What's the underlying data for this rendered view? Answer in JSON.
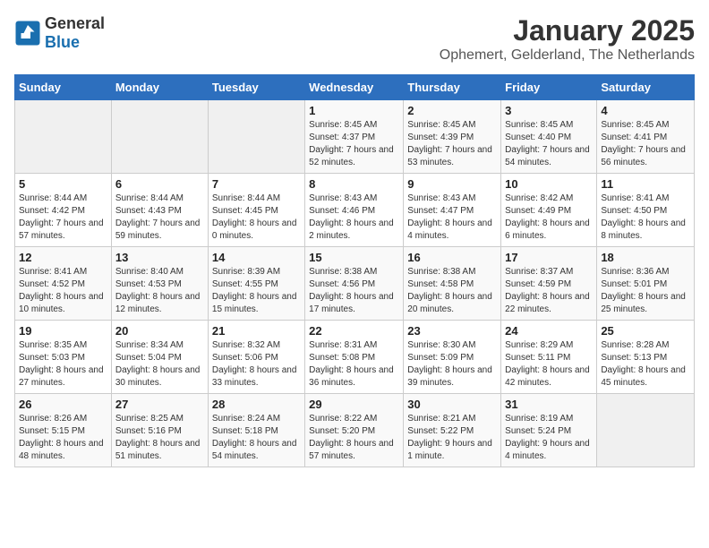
{
  "header": {
    "logo_general": "General",
    "logo_blue": "Blue",
    "month_year": "January 2025",
    "location": "Ophemert, Gelderland, The Netherlands"
  },
  "calendar": {
    "days_of_week": [
      "Sunday",
      "Monday",
      "Tuesday",
      "Wednesday",
      "Thursday",
      "Friday",
      "Saturday"
    ],
    "weeks": [
      [
        {
          "day": "",
          "info": ""
        },
        {
          "day": "",
          "info": ""
        },
        {
          "day": "",
          "info": ""
        },
        {
          "day": "1",
          "info": "Sunrise: 8:45 AM\nSunset: 4:37 PM\nDaylight: 7 hours and 52 minutes."
        },
        {
          "day": "2",
          "info": "Sunrise: 8:45 AM\nSunset: 4:39 PM\nDaylight: 7 hours and 53 minutes."
        },
        {
          "day": "3",
          "info": "Sunrise: 8:45 AM\nSunset: 4:40 PM\nDaylight: 7 hours and 54 minutes."
        },
        {
          "day": "4",
          "info": "Sunrise: 8:45 AM\nSunset: 4:41 PM\nDaylight: 7 hours and 56 minutes."
        }
      ],
      [
        {
          "day": "5",
          "info": "Sunrise: 8:44 AM\nSunset: 4:42 PM\nDaylight: 7 hours and 57 minutes."
        },
        {
          "day": "6",
          "info": "Sunrise: 8:44 AM\nSunset: 4:43 PM\nDaylight: 7 hours and 59 minutes."
        },
        {
          "day": "7",
          "info": "Sunrise: 8:44 AM\nSunset: 4:45 PM\nDaylight: 8 hours and 0 minutes."
        },
        {
          "day": "8",
          "info": "Sunrise: 8:43 AM\nSunset: 4:46 PM\nDaylight: 8 hours and 2 minutes."
        },
        {
          "day": "9",
          "info": "Sunrise: 8:43 AM\nSunset: 4:47 PM\nDaylight: 8 hours and 4 minutes."
        },
        {
          "day": "10",
          "info": "Sunrise: 8:42 AM\nSunset: 4:49 PM\nDaylight: 8 hours and 6 minutes."
        },
        {
          "day": "11",
          "info": "Sunrise: 8:41 AM\nSunset: 4:50 PM\nDaylight: 8 hours and 8 minutes."
        }
      ],
      [
        {
          "day": "12",
          "info": "Sunrise: 8:41 AM\nSunset: 4:52 PM\nDaylight: 8 hours and 10 minutes."
        },
        {
          "day": "13",
          "info": "Sunrise: 8:40 AM\nSunset: 4:53 PM\nDaylight: 8 hours and 12 minutes."
        },
        {
          "day": "14",
          "info": "Sunrise: 8:39 AM\nSunset: 4:55 PM\nDaylight: 8 hours and 15 minutes."
        },
        {
          "day": "15",
          "info": "Sunrise: 8:38 AM\nSunset: 4:56 PM\nDaylight: 8 hours and 17 minutes."
        },
        {
          "day": "16",
          "info": "Sunrise: 8:38 AM\nSunset: 4:58 PM\nDaylight: 8 hours and 20 minutes."
        },
        {
          "day": "17",
          "info": "Sunrise: 8:37 AM\nSunset: 4:59 PM\nDaylight: 8 hours and 22 minutes."
        },
        {
          "day": "18",
          "info": "Sunrise: 8:36 AM\nSunset: 5:01 PM\nDaylight: 8 hours and 25 minutes."
        }
      ],
      [
        {
          "day": "19",
          "info": "Sunrise: 8:35 AM\nSunset: 5:03 PM\nDaylight: 8 hours and 27 minutes."
        },
        {
          "day": "20",
          "info": "Sunrise: 8:34 AM\nSunset: 5:04 PM\nDaylight: 8 hours and 30 minutes."
        },
        {
          "day": "21",
          "info": "Sunrise: 8:32 AM\nSunset: 5:06 PM\nDaylight: 8 hours and 33 minutes."
        },
        {
          "day": "22",
          "info": "Sunrise: 8:31 AM\nSunset: 5:08 PM\nDaylight: 8 hours and 36 minutes."
        },
        {
          "day": "23",
          "info": "Sunrise: 8:30 AM\nSunset: 5:09 PM\nDaylight: 8 hours and 39 minutes."
        },
        {
          "day": "24",
          "info": "Sunrise: 8:29 AM\nSunset: 5:11 PM\nDaylight: 8 hours and 42 minutes."
        },
        {
          "day": "25",
          "info": "Sunrise: 8:28 AM\nSunset: 5:13 PM\nDaylight: 8 hours and 45 minutes."
        }
      ],
      [
        {
          "day": "26",
          "info": "Sunrise: 8:26 AM\nSunset: 5:15 PM\nDaylight: 8 hours and 48 minutes."
        },
        {
          "day": "27",
          "info": "Sunrise: 8:25 AM\nSunset: 5:16 PM\nDaylight: 8 hours and 51 minutes."
        },
        {
          "day": "28",
          "info": "Sunrise: 8:24 AM\nSunset: 5:18 PM\nDaylight: 8 hours and 54 minutes."
        },
        {
          "day": "29",
          "info": "Sunrise: 8:22 AM\nSunset: 5:20 PM\nDaylight: 8 hours and 57 minutes."
        },
        {
          "day": "30",
          "info": "Sunrise: 8:21 AM\nSunset: 5:22 PM\nDaylight: 9 hours and 1 minute."
        },
        {
          "day": "31",
          "info": "Sunrise: 8:19 AM\nSunset: 5:24 PM\nDaylight: 9 hours and 4 minutes."
        },
        {
          "day": "",
          "info": ""
        }
      ]
    ]
  }
}
